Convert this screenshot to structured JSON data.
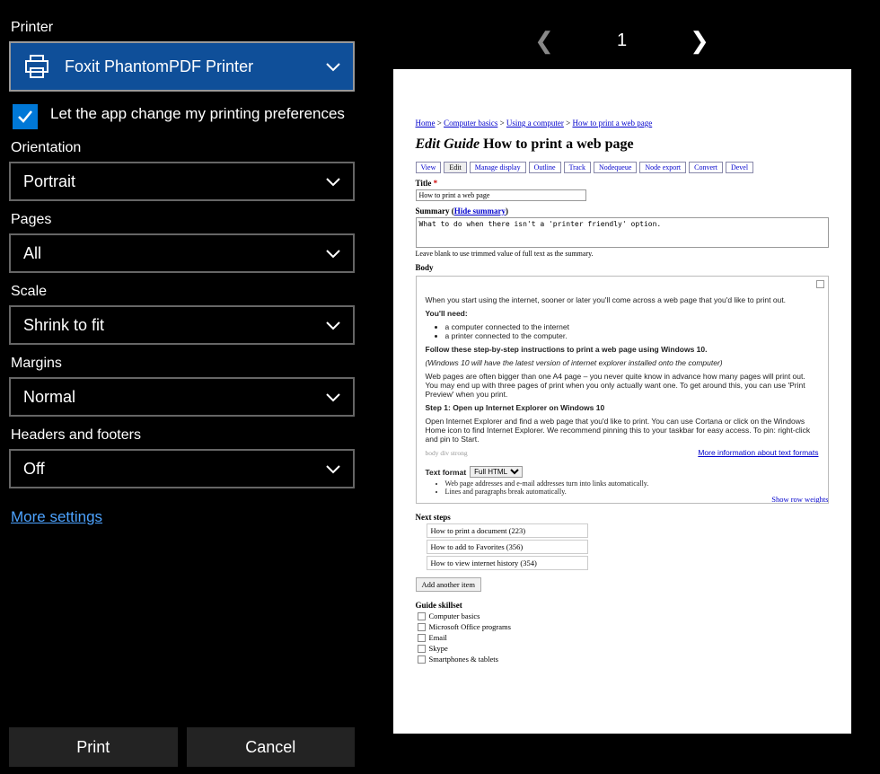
{
  "printer": {
    "label": "Printer",
    "selected": "Foxit PhantomPDF Printer"
  },
  "checkbox": {
    "label": "Let the app change my printing preferences"
  },
  "orientation": {
    "label": "Orientation",
    "value": "Portrait"
  },
  "pages": {
    "label": "Pages",
    "value": "All"
  },
  "scale": {
    "label": "Scale",
    "value": "Shrink to fit"
  },
  "margins": {
    "label": "Margins",
    "value": "Normal"
  },
  "headers": {
    "label": "Headers and footers",
    "value": "Off"
  },
  "more": "More settings",
  "buttons": {
    "print": "Print",
    "cancel": "Cancel"
  },
  "nav": {
    "page": "1"
  },
  "preview": {
    "breadcrumbs": [
      "Home",
      "Computer basics",
      "Using a computer",
      "How to print a web page"
    ],
    "title_prefix": "Edit Guide",
    "title": "How to print a web page",
    "tabs": [
      "View",
      "Edit",
      "Manage display",
      "Outline",
      "Track",
      "Nodequeue",
      "Node export",
      "Convert",
      "Devel"
    ],
    "title_label": "Title",
    "title_value": "How to print a web page",
    "summary_label": "Summary",
    "summary_link": "Hide summary",
    "summary_value": "What to do when there isn't a 'printer friendly' option.",
    "summary_hint": "Leave blank to use trimmed value of full text as the summary.",
    "body_label": "Body",
    "body": {
      "p1": "When you start using the internet, sooner or later you'll come across a web page that you'd like to print out.",
      "need_h": "You'll need:",
      "need1": "a computer connected to the internet",
      "need2": "a printer connected to the computer.",
      "follow": "Follow these step-by-step instructions to print a web page using Windows 10.",
      "note": "(Windows 10 will have the latest version of internet explorer installed onto the computer)",
      "p2": "Web pages are often bigger than one A4 page – you never quite know in advance how many pages will print out. You may end up with three pages of print when you only actually want one. To get around this, you can use 'Print Preview' when you print.",
      "step1": "Step 1: Open up Internet Explorer on Windows 10",
      "p3": "Open Internet Explorer and find a web page that you'd like to print. You can use Cortana or click on the Windows Home icon to find Internet Explorer. We recommend pinning this to your taskbar for easy access. To pin: right-click and pin to Start.",
      "tools": "body  div  strong",
      "more_info": "More information about text formats",
      "format_label": "Text format",
      "format_value": "Full HTML",
      "f1": "Web page addresses and e-mail addresses turn into links automatically.",
      "f2": "Lines and paragraphs break automatically."
    },
    "next_steps_label": "Next steps",
    "show_weights": "Show row weights",
    "steps": [
      "How to print a document (223)",
      "How to add to Favorites  (356)",
      "How to view internet history (354)"
    ],
    "add_item": "Add another item",
    "skillset_label": "Guide skillset",
    "skills": [
      "Computer basics",
      "Microsoft Office programs",
      "Email",
      "Skype",
      "Smartphones & tablets"
    ]
  }
}
